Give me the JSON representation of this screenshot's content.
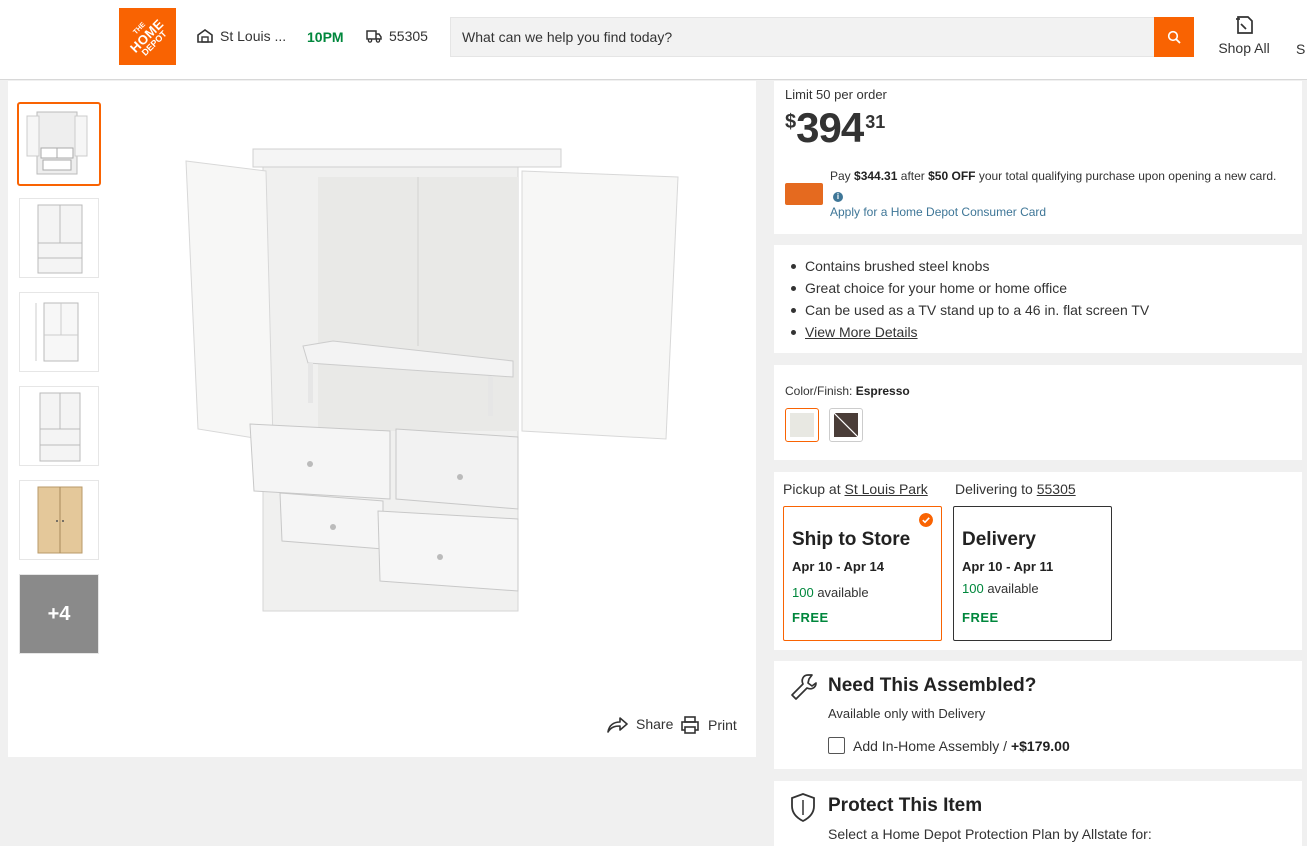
{
  "header": {
    "logo_line1": "THE",
    "logo_line2": "HOME",
    "logo_line3": "DEPOT",
    "store_name": "St Louis ...",
    "store_hours": "10PM",
    "delivery_zip": "55305",
    "search_placeholder": "What can we help you find today?",
    "shop_all": "Shop All",
    "cut_label": "S"
  },
  "gallery": {
    "more_count": "+4",
    "share_label": "Share",
    "print_label": "Print"
  },
  "price_box": {
    "limit": "Limit 50 per order",
    "currency": "$",
    "dollars": "394",
    "cents": "31",
    "promo_pay": "Pay",
    "promo_amount": "$344.31",
    "promo_after": "after",
    "promo_discount": "$50 OFF",
    "promo_rest": "your total qualifying purchase upon opening a new card.",
    "apply_link": "Apply for a Home Depot Consumer Card"
  },
  "highlights": [
    "Contains brushed steel knobs",
    "Great choice for your home or home office",
    "Can be used as a TV stand up to a 46 in. flat screen TV",
    "View More Details"
  ],
  "color": {
    "label": "Color/Finish:",
    "value": "Espresso",
    "swatch_white": "#e8e8e2",
    "swatch_espresso": "#4a3d38"
  },
  "fulfillment": {
    "pickup_prefix": "Pickup at",
    "pickup_store": "St Louis Park",
    "delivery_prefix": "Delivering to",
    "delivery_zip": "55305",
    "ship": {
      "title": "Ship to Store",
      "dates": "Apr 10 - Apr 14",
      "qty": "100",
      "avail": "available",
      "price": "FREE"
    },
    "delivery": {
      "title": "Delivery",
      "dates": "Apr 10 - Apr 11",
      "qty": "100",
      "avail": "available",
      "price": "FREE"
    }
  },
  "assembly": {
    "title": "Need This Assembled?",
    "subtitle": "Available only with Delivery",
    "checkbox_label": "Add In-Home Assembly /",
    "checkbox_price": "+$179.00"
  },
  "protection": {
    "title": "Protect This Item",
    "subtitle": "Select a Home Depot Protection Plan by Allstate for:"
  },
  "colors": {
    "brand_orange": "#f96302",
    "green": "#00873c",
    "link_blue": "#3e7697"
  }
}
